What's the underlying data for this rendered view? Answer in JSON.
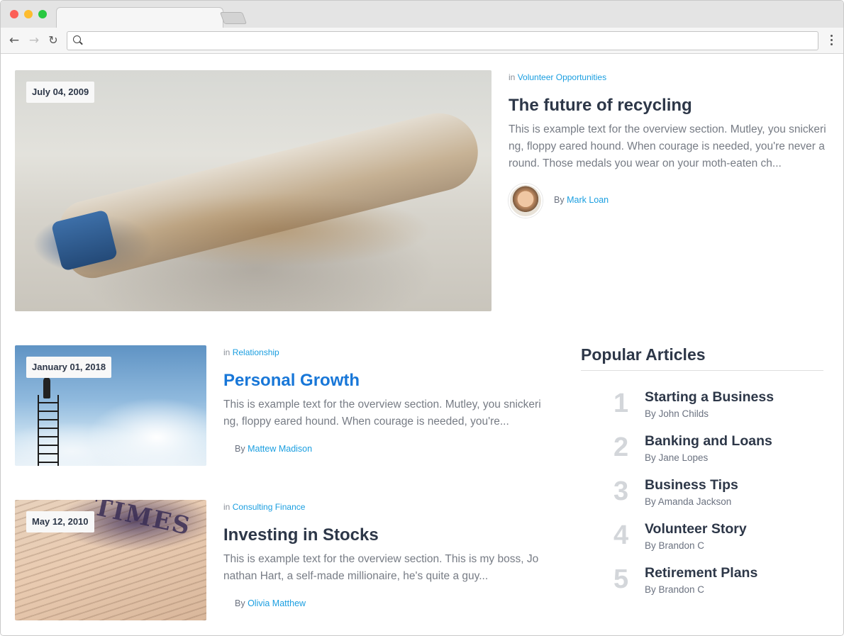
{
  "featured": {
    "date": "July 04, 2009",
    "category_prefix": "in",
    "category": "Volunteer Opportunities",
    "title": "The future of recycling",
    "excerpt": "This is example text for the overview section. Mutley, you snickering, floppy eared hound. When courage is needed, you're never around. Those medals you wear on your moth-eaten ch...",
    "by_prefix": "By",
    "author": "Mark Loan"
  },
  "articles": [
    {
      "date": "January 01, 2018",
      "category_prefix": "in",
      "category": "Relationship",
      "title": "Personal Growth",
      "excerpt": "This is example text for the overview section. Mutley, you snickering, floppy eared hound. When courage is needed, you're...",
      "by_prefix": "By",
      "author": "Mattew Madison"
    },
    {
      "date": "May 12, 2010",
      "category_prefix": "in",
      "category": "Consulting Finance",
      "title": "Investing in Stocks",
      "excerpt": "This is example text for the overview section. This is my boss, Jonathan Hart, a self-made millionaire, he's quite a guy...",
      "by_prefix": "By",
      "author": "Olivia Matthew",
      "image_text": "TIMES"
    }
  ],
  "popular": {
    "heading": "Popular Articles",
    "items": [
      {
        "rank": "1",
        "title": "Starting a Business",
        "author": "By John Childs"
      },
      {
        "rank": "2",
        "title": "Banking and Loans",
        "author": "By Jane Lopes"
      },
      {
        "rank": "3",
        "title": "Business Tips",
        "author": "By Amanda Jackson"
      },
      {
        "rank": "4",
        "title": "Volunteer Story",
        "author": "By Brandon C"
      },
      {
        "rank": "5",
        "title": "Retirement Plans",
        "author": "By Brandon C"
      }
    ]
  },
  "colors": {
    "link": "#1a9ee0",
    "title_link": "#1877d8",
    "heading": "#2d3748",
    "rank_number": "#d3d6da"
  }
}
